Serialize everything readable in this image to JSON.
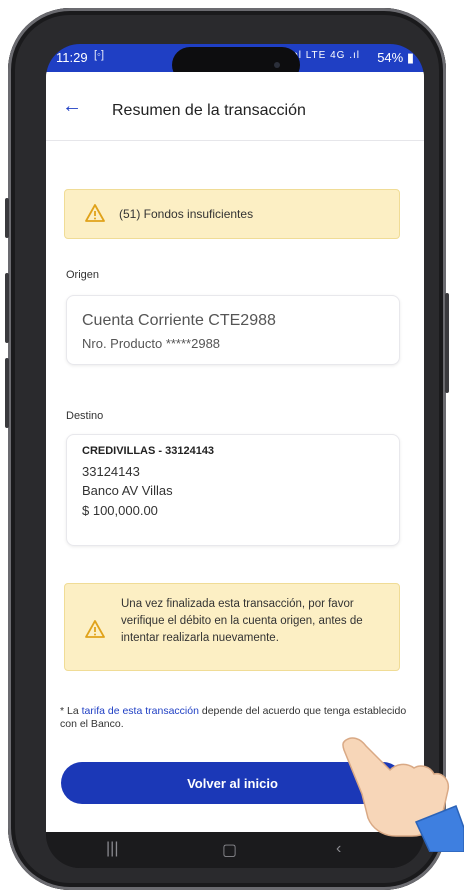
{
  "status_bar": {
    "time": "11:29",
    "cast_icon": "cast-icon",
    "signal_text": "⊗ ◀ Vol LTE 4G .ıl",
    "battery": "54%"
  },
  "header": {
    "back_icon": "arrow-left-icon",
    "title": "Resumen de la transacción"
  },
  "error_alert": {
    "icon": "warning-icon",
    "text": "(51) Fondos insuficientes"
  },
  "origin": {
    "label": "Origen",
    "account_name": "Cuenta Corriente CTE2988",
    "product_number": "Nro. Producto *****2988"
  },
  "destination": {
    "label": "Destino",
    "name": "CREDIVILLAS - 33124143",
    "account": "33124143",
    "bank": "Banco AV Villas",
    "amount": "$ 100,000.00"
  },
  "info_alert": {
    "icon": "warning-icon",
    "text": "Una vez finalizada esta transacción, por favor verifique el débito en la cuenta origen, antes de intentar realizarla nuevamente."
  },
  "footnote": {
    "prefix": "* La ",
    "link": "tarifa de esta transacción",
    "suffix": " depende del acuerdo que tenga establecido con el Banco."
  },
  "primary_button": {
    "label": "Volver al inicio"
  },
  "nav_bar": {
    "recents": "recents-icon",
    "home": "home-icon",
    "back": "back-icon"
  },
  "colors": {
    "primary": "#1b38b7",
    "status_bar": "#1f3fc4",
    "alert_bg": "#fcefc4",
    "warning": "#e0a21a"
  }
}
